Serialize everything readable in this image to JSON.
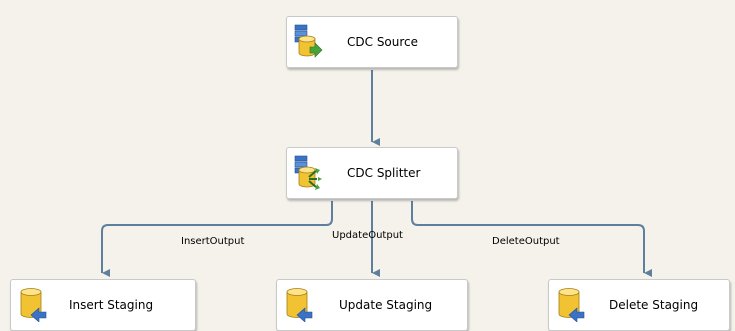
{
  "canvas": {
    "background": "#f5f2eb",
    "connector_color": "#5f7f9f"
  },
  "nodes": {
    "cdc_source": {
      "label": "CDC Source",
      "icon": "data-source-icon"
    },
    "cdc_splitter": {
      "label": "CDC Splitter",
      "icon": "splitter-icon"
    },
    "insert_staging": {
      "label": "Insert Staging",
      "icon": "database-destination-icon"
    },
    "update_staging": {
      "label": "Update Staging",
      "icon": "database-destination-icon"
    },
    "delete_staging": {
      "label": "Delete Staging",
      "icon": "database-destination-icon"
    }
  },
  "outputs": {
    "insert": "InsertOutput",
    "update": "UpdateOutput",
    "delete": "DeleteOutput"
  }
}
